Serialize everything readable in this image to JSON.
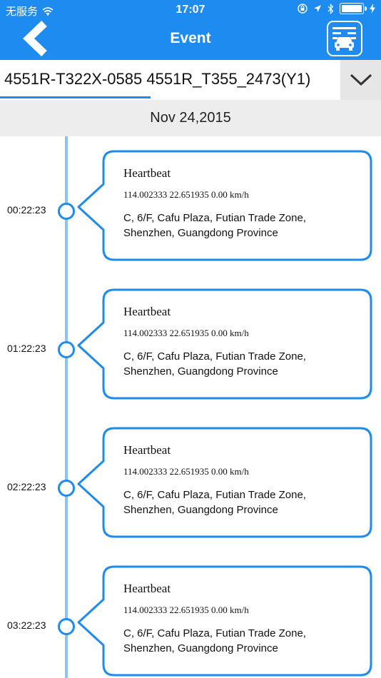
{
  "status_bar": {
    "carrier": "无服务",
    "time": "17:07"
  },
  "nav": {
    "title": "Event"
  },
  "device_selector": {
    "value": "4551R-T322X-0585 4551R_T355_2473(Y1)"
  },
  "date": "Nov 24,2015",
  "events": [
    {
      "time": "00:22:23",
      "title": "Heartbeat",
      "coords": "114.002333 22.651935 0.00 km/h",
      "address": "C, 6/F, Cafu Plaza, Futian Trade Zone, Shenzhen, Guangdong Province"
    },
    {
      "time": "01:22:23",
      "title": "Heartbeat",
      "coords": "114.002333 22.651935 0.00 km/h",
      "address": "C, 6/F, Cafu Plaza, Futian Trade Zone, Shenzhen, Guangdong Province"
    },
    {
      "time": "02:22:23",
      "title": "Heartbeat",
      "coords": "114.002333 22.651935 0.00 km/h",
      "address": "C, 6/F, Cafu Plaza, Futian Trade Zone, Shenzhen, Guangdong Province"
    },
    {
      "time": "03:22:23",
      "title": "Heartbeat",
      "coords": "114.002333 22.651935 0.00 km/h",
      "address": "C, 6/F, Cafu Plaza, Futian Trade Zone, Shenzhen, Guangdong Province"
    }
  ],
  "colors": {
    "primary": "#1e8bf0",
    "timeline": "#8cc3f5",
    "date_bg": "#ededed",
    "dropdown_bg": "#e6e6e6"
  },
  "icons": {
    "back": "chevron-left-icon",
    "vehicle": "vehicle-list-icon",
    "dropdown": "chevron-down-icon",
    "wifi": "wifi-icon",
    "lock": "rotation-lock-icon",
    "location": "location-arrow-icon",
    "bluetooth": "bluetooth-icon",
    "battery": "battery-icon",
    "charging": "charging-icon"
  }
}
